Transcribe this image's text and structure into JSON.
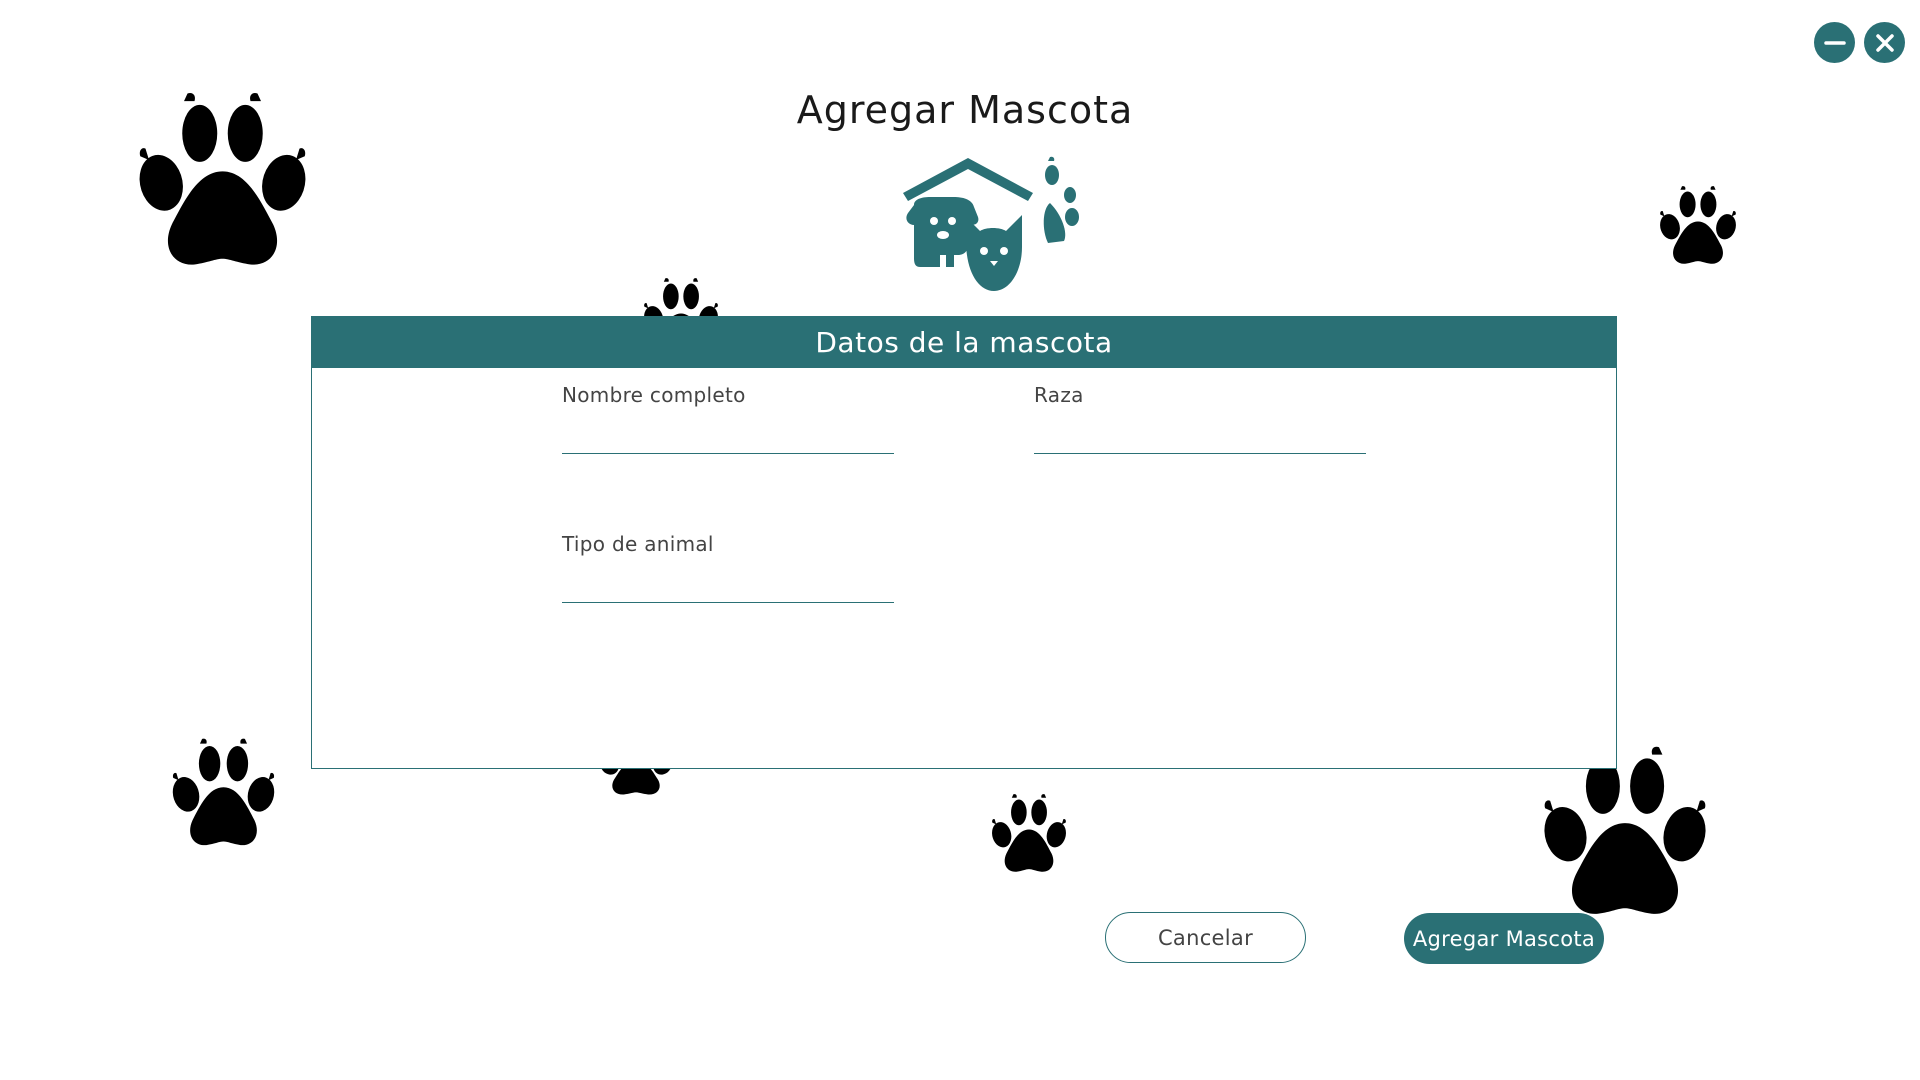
{
  "colors": {
    "accent": "#2a7075",
    "background": "#ffffff"
  },
  "window_controls": {
    "minimize_icon": "minus-circle-icon",
    "close_icon": "x-circle-icon"
  },
  "header": {
    "title": "Agregar Mascota",
    "hero_icon": "pets-house-icon"
  },
  "card": {
    "title": "Datos de la mascota",
    "fields": {
      "nombre": {
        "label": "Nombre completo",
        "value": ""
      },
      "raza": {
        "label": "Raza",
        "value": ""
      },
      "tipo": {
        "label": "Tipo de animal",
        "value": ""
      }
    }
  },
  "actions": {
    "cancel_label": "Cancelar",
    "submit_label": "Agregar Mascota"
  },
  "decorations": {
    "paw_icon": "paw-print-icon"
  }
}
